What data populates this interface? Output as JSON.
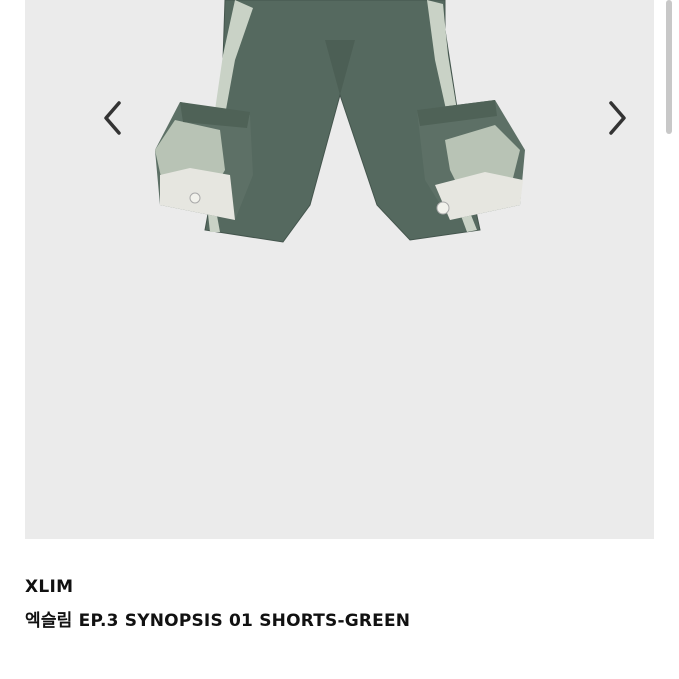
{
  "product": {
    "brand": "XLIM",
    "name": "엑슬림 EP.3 SYNOPSIS 01 SHORTS-GREEN"
  },
  "gallery": {
    "prev_icon": "chevron-left-icon",
    "next_icon": "chevron-right-icon"
  },
  "colors": {
    "shorts_green": "#55695f",
    "pocket_light": "#c9d2c6",
    "background": "#ebebeb"
  }
}
